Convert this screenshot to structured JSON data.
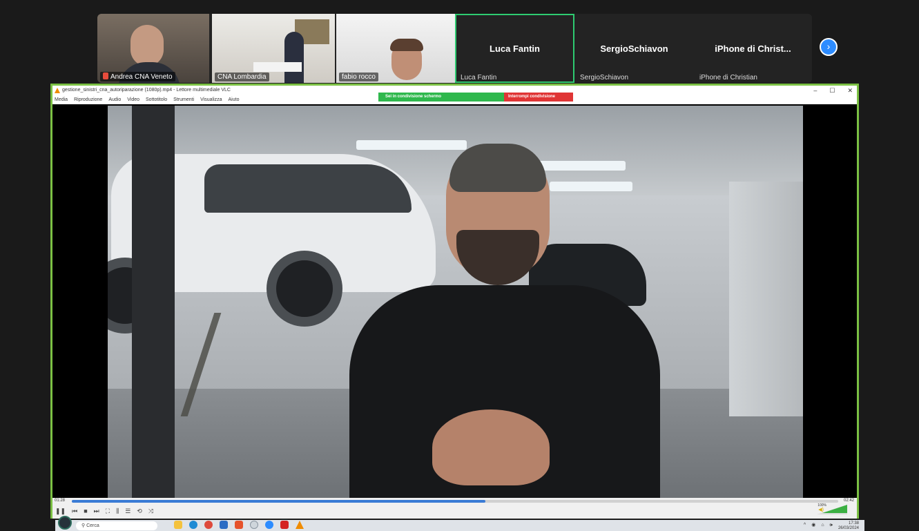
{
  "participants": [
    {
      "name": "Andrea CNA Veneto",
      "muted": true
    },
    {
      "name": "CNA Lombardia"
    },
    {
      "name": "fabio rocco"
    },
    {
      "display": "Luca Fantin",
      "name": "Luca Fantin",
      "active": true
    },
    {
      "display": "SergioSchiavon",
      "name": "SergioSchiavon"
    },
    {
      "display": "iPhone di Christ...",
      "name": "iPhone di Christian"
    }
  ],
  "next_page_icon": "chevron-right-icon",
  "vlc": {
    "title": "gestione_sinistri_cna_autoriparazione (1080p).mp4 - Lettore multimediale VLC",
    "window_controls": [
      "–",
      "☐",
      "✕"
    ],
    "menu": [
      "Media",
      "Riproduzione",
      "Audio",
      "Video",
      "Sottotitolo",
      "Strumenti",
      "Visualizza",
      "Aiuto"
    ],
    "time_elapsed": "01:28",
    "time_total": "02:42",
    "progress": 0.54,
    "volume_label": "100%",
    "controls": [
      "❚❚",
      "⏮",
      "■",
      "⏭",
      "⛶",
      "⫼",
      "☰",
      "⟲",
      "⤨"
    ]
  },
  "share_banner": {
    "status": "Sei in condivisione schermo",
    "stop": "Interrompi condivisione"
  },
  "taskbar": {
    "search_placeholder": "Cerca",
    "time": "17:38",
    "date": "26/03/2024"
  },
  "colors": {
    "active_border": "#2ecc71",
    "share_border": "#7bc043",
    "share_green": "#2fb84d",
    "stop_red": "#e03535",
    "zoom_blue": "#2d8cff"
  }
}
